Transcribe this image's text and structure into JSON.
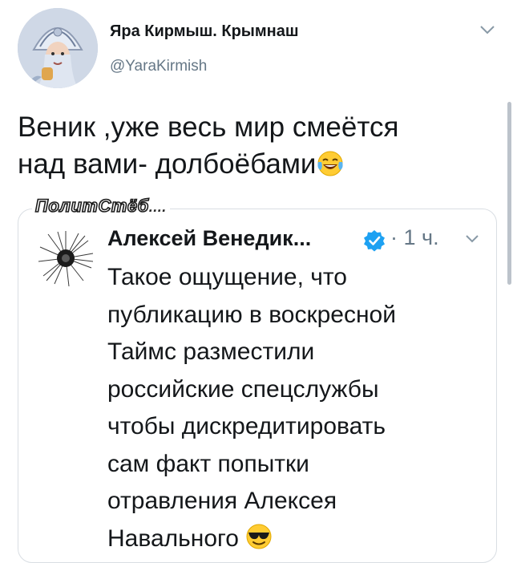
{
  "author": {
    "display_name": "Яра Кирмыш. Крымнаш",
    "handle": "@YaraKirmish"
  },
  "tweet": {
    "lines": [
      "Веник ,уже весь мир смеётся",
      "над вами- долбоёбами"
    ],
    "emoji": "face-with-tears-of-joy"
  },
  "watermark": {
    "text": "ПолитСтёб",
    "dots": "...."
  },
  "quoted_tweet": {
    "display_name": "Алексей Венедик...",
    "time": "· 1 ч.",
    "lines": [
      "Такое ощущение, что",
      "публикацию в  воскресной",
      "Таймс разместили",
      "российские спецслужбы",
      "чтобы дискредитировать",
      "сам факт попытки",
      "отравления Алексея",
      "Навального"
    ],
    "emoji": "smiling-face-with-sunglasses"
  },
  "colors": {
    "text": "#14171a",
    "secondary": "#657786",
    "verified": "#1da1f2",
    "border": "#d9dee3"
  }
}
